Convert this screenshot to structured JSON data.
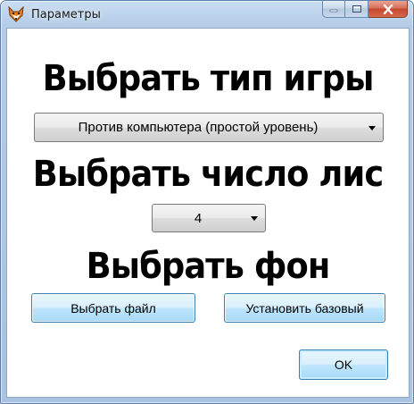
{
  "window": {
    "title": "Параметры",
    "icon": "fox-icon",
    "controls": [
      "minimize-icon",
      "maximize-icon",
      "close-icon"
    ]
  },
  "game_type": {
    "heading": "Выбрать тип игры",
    "selected": "Против компьютера (простой уровень)"
  },
  "fox_count": {
    "heading": "Выбрать число лис",
    "selected": "4"
  },
  "background": {
    "heading": "Выбрать фон",
    "choose_file_label": "Выбрать файл",
    "set_default_label": "Установить базовый"
  },
  "ok_label": "OK",
  "colors": {
    "titlebar": "#b3cbe6",
    "close_button": "#c4472c",
    "button_face": "#bee6fd"
  }
}
